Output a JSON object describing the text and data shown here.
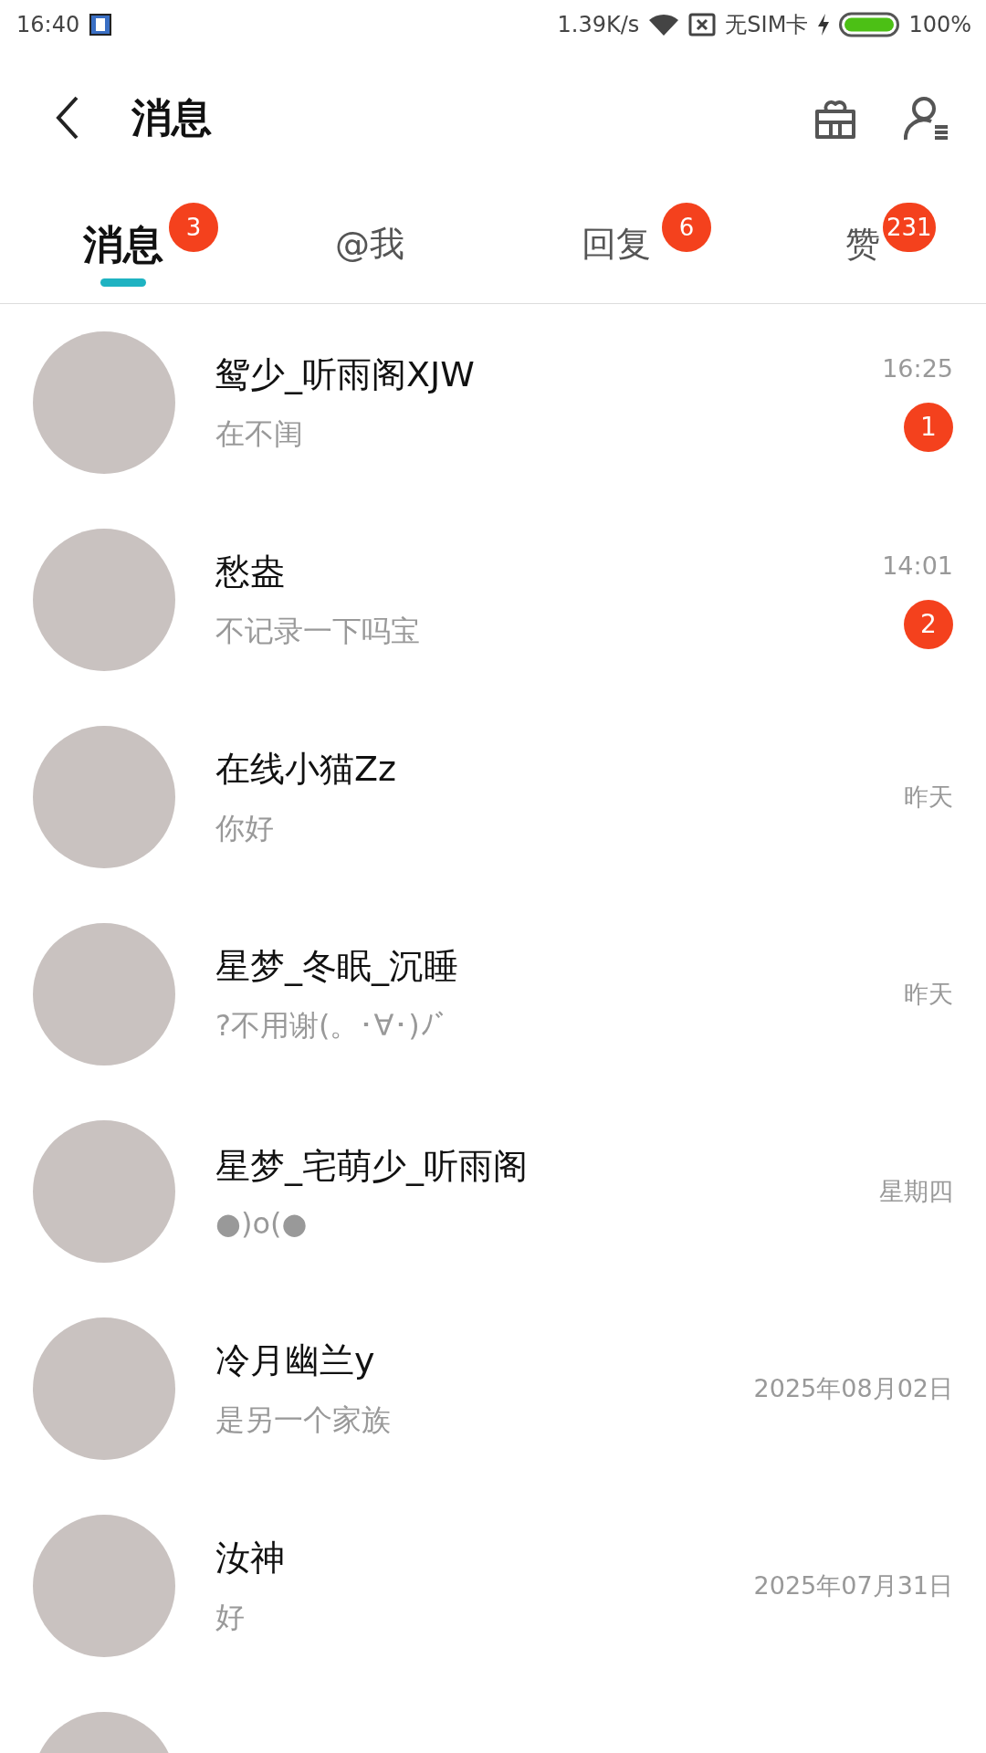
{
  "status_bar": {
    "time": "16:40",
    "net_speed": "1.39K/s",
    "sim": "无SIM卡",
    "battery": "100%"
  },
  "header": {
    "title": "消息"
  },
  "tabs": [
    {
      "label": "消息",
      "selected": true,
      "badge": "3"
    },
    {
      "label": "@我",
      "selected": false
    },
    {
      "label": "回复",
      "selected": false,
      "badge": "6"
    },
    {
      "label": "赞",
      "selected": false,
      "badge": "231"
    }
  ],
  "conversations": [
    {
      "name": "鸳少_听雨阁XJW",
      "preview": "在不闺",
      "time": "16:25",
      "unread": "1"
    },
    {
      "name": "愁盎",
      "preview": "不记录一下吗宝",
      "time": "14:01",
      "unread": "2"
    },
    {
      "name": "在线小猫Zz",
      "preview": "你好",
      "time": "昨天"
    },
    {
      "name": "星梦_冬眠_沉睡",
      "preview": "?不用谢(。･∀･)ﾉﾞ",
      "time": "昨天"
    },
    {
      "name": "星梦_宅萌少_听雨阁",
      "preview": "●)o(●",
      "time": "星期四"
    },
    {
      "name": "冷月幽兰y",
      "preview": "是另一个家族",
      "time": "2025年08月02日"
    },
    {
      "name": "汝神",
      "preview": "好",
      "time": "2025年07月31日"
    }
  ]
}
